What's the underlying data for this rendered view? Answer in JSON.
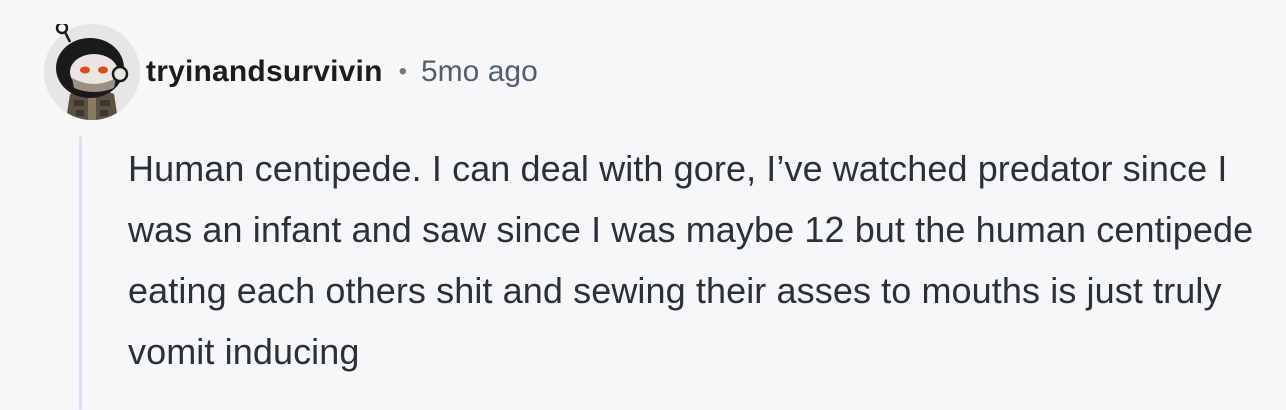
{
  "comment": {
    "author": {
      "username": "tryinandsurvivin",
      "avatar_icon": "snoo-avatar-icon"
    },
    "separator": "•",
    "timestamp": "5mo ago",
    "text": "Human centipede. I can deal with gore, I’ve watched predator since I was an infant and saw since I was maybe 12 but the human centipede eating each others shit and sewing their asses to mouths is just truly vomit inducing"
  },
  "colors": {
    "background": "#f6f7f8",
    "username": "#1c1c1c",
    "meta": "#52606d",
    "body_text": "#2a3238",
    "thread_line": "#dce1e5"
  }
}
